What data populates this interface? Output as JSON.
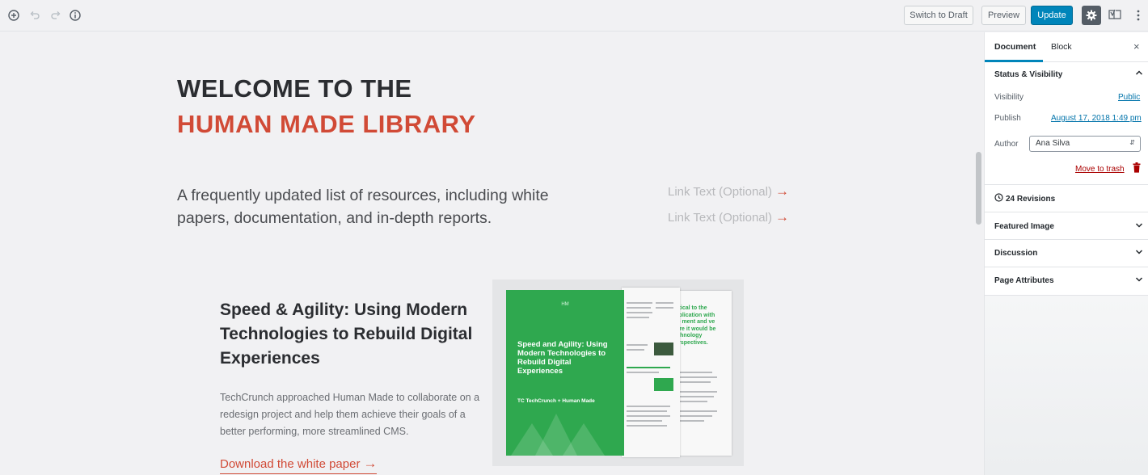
{
  "toolbar": {
    "icons": [
      "add-block-icon",
      "undo-icon",
      "redo-icon",
      "info-icon"
    ],
    "switch_to_draft": "Switch to Draft",
    "preview": "Preview",
    "update": "Update",
    "settings_icon": "gear-icon",
    "yoast_icon": "yoast-icon",
    "more_icon": "more-vertical-icon"
  },
  "content": {
    "heading_line1": "WELCOME TO THE",
    "heading_line2": "HUMAN MADE LIBRARY",
    "intro": "A frequently updated list of resources, including white papers, documentation, and in-depth reports.",
    "links": [
      "Link Text (Optional)",
      "Link Text (Optional)"
    ],
    "arrow": "→",
    "card": {
      "title": "Speed & Agility: Using Modern Technologies to Rebuild Digital Experiences",
      "description": "TechCrunch approached Human Made to collaborate on a redesign project and help them achieve their goals of a better performing, more streamlined CMS.",
      "download_label": "Download the white paper",
      "report": {
        "mark": "HM",
        "cover_title": "Speed and Agility: Using Modern Technologies to Rebuild Digital Experiences",
        "cover_logos": "TC TechCrunch  +  Human Made",
        "pull_quote": "critical to the publication with the ment and ve were it would be technology perspectives."
      }
    }
  },
  "sidebar": {
    "tabs": [
      "Document",
      "Block"
    ],
    "close": "×",
    "status_panel": {
      "title": "Status & Visibility",
      "visibility_label": "Visibility",
      "visibility_value": "Public",
      "publish_label": "Publish",
      "publish_value": "August 17, 2018 1:49 pm",
      "author_label": "Author",
      "author_value": "Ana Silva",
      "move_to_trash": "Move to trash"
    },
    "revisions": "24 Revisions",
    "panels": [
      "Featured Image",
      "Discussion",
      "Page Attributes"
    ]
  },
  "colors": {
    "accent": "#d14a36",
    "primary_button": "#0085ba",
    "report_green": "#2fa84f"
  }
}
